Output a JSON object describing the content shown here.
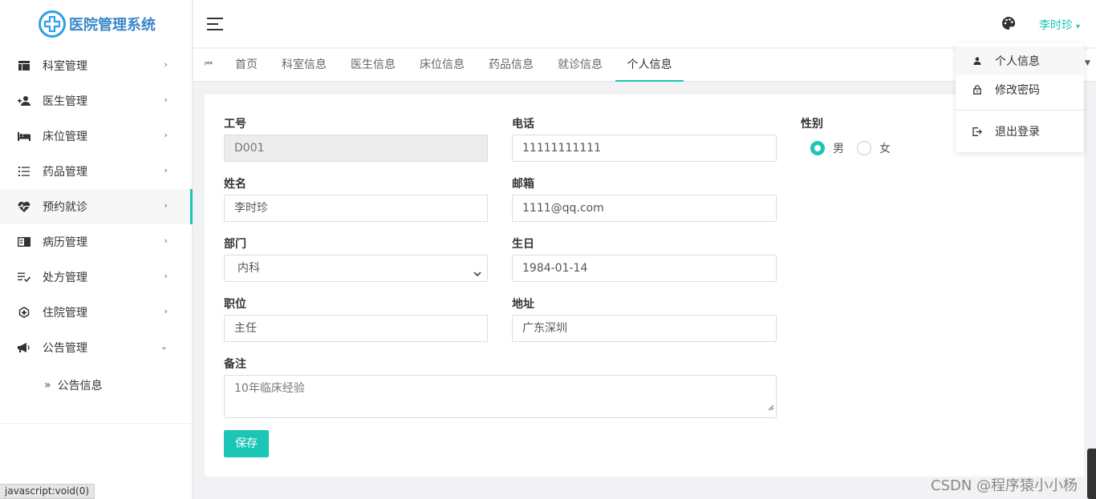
{
  "app": {
    "title": "医院管理系统",
    "brand_color": "#2d9fe6",
    "accent_color": "#1bc6b6"
  },
  "sidebar": {
    "items": [
      {
        "label": "科室管理",
        "icon": "layout-icon",
        "arrow": "›"
      },
      {
        "label": "医生管理",
        "icon": "add-user-icon",
        "arrow": "›"
      },
      {
        "label": "床位管理",
        "icon": "bed-icon",
        "arrow": "›"
      },
      {
        "label": "药品管理",
        "icon": "list-icon",
        "arrow": "›"
      },
      {
        "label": "预约就诊",
        "icon": "heartbeat-icon",
        "arrow": "›",
        "active": true
      },
      {
        "label": "病历管理",
        "icon": "record-icon",
        "arrow": "›"
      },
      {
        "label": "处方管理",
        "icon": "checklist-icon",
        "arrow": "›"
      },
      {
        "label": "住院管理",
        "icon": "hospital-shield-icon",
        "arrow": "›"
      },
      {
        "label": "公告管理",
        "icon": "megaphone-icon",
        "arrow": "⌄",
        "expanded": true
      }
    ],
    "subitems": [
      {
        "label": "公告信息",
        "prefix": "»"
      }
    ]
  },
  "header": {
    "user_name": "李时珍",
    "caret": "▾"
  },
  "tabs": {
    "items": [
      "首页",
      "科室信息",
      "医生信息",
      "床位信息",
      "药品信息",
      "就诊信息",
      "个人信息"
    ],
    "active": "个人信息"
  },
  "form": {
    "labels": {
      "id": "工号",
      "phone": "电话",
      "gender": "性别",
      "name": "姓名",
      "email": "邮箱",
      "dept": "部门",
      "birthday": "生日",
      "title": "职位",
      "address": "地址",
      "remark": "备注"
    },
    "values": {
      "id": "D001",
      "phone": "11111111111",
      "name": "李时珍",
      "email": "1111@qq.com",
      "dept": "内科",
      "birthday": "1984-01-14",
      "title": "主任",
      "address": "广东深圳",
      "remark": "10年临床经验"
    },
    "gender_options": [
      {
        "label": "男",
        "checked": true
      },
      {
        "label": "女",
        "checked": false
      }
    ],
    "save_label": "保存"
  },
  "dropdown": {
    "items": [
      {
        "label": "个人信息",
        "icon": "person-icon"
      },
      {
        "label": "修改密码",
        "icon": "lock-icon"
      },
      {
        "label": "退出登录",
        "icon": "logout-icon"
      }
    ]
  },
  "statusbar": {
    "text": "javascript:void(0)"
  },
  "watermark": "CSDN @程序猿小小杨"
}
